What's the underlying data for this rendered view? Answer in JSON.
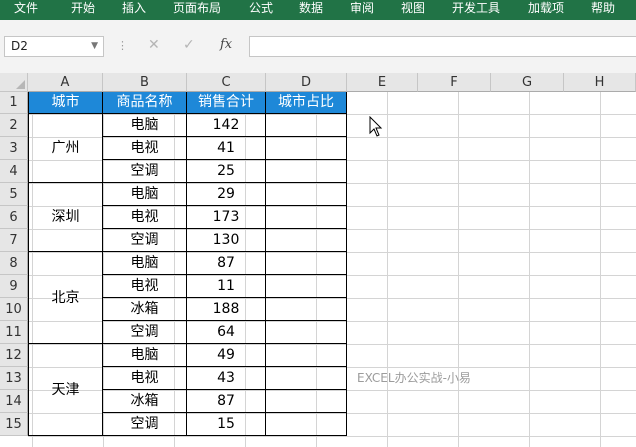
{
  "ribbon": {
    "tabs": [
      "文件",
      "开始",
      "插入",
      "页面布局",
      "公式",
      "数据",
      "审阅",
      "视图",
      "开发工具",
      "加载项",
      "帮助"
    ]
  },
  "formula_bar": {
    "name_box": "D2",
    "cancel": "✕",
    "enter": "✓",
    "fx": "fx",
    "formula": ""
  },
  "columns": [
    "A",
    "B",
    "C",
    "D",
    "E",
    "F",
    "G",
    "H"
  ],
  "rows": [
    "1",
    "2",
    "3",
    "4",
    "5",
    "6",
    "7",
    "8",
    "9",
    "10",
    "11",
    "12",
    "13",
    "14",
    "15"
  ],
  "table": {
    "headers": [
      "城市",
      "商品名称",
      "销售合计",
      "城市占比"
    ],
    "groups": [
      {
        "city": "广州",
        "items": [
          [
            "电脑",
            "142"
          ],
          [
            "电视",
            "41"
          ],
          [
            "空调",
            "25"
          ]
        ]
      },
      {
        "city": "深圳",
        "items": [
          [
            "电脑",
            "29"
          ],
          [
            "电视",
            "173"
          ],
          [
            "空调",
            "130"
          ]
        ]
      },
      {
        "city": "北京",
        "items": [
          [
            "电脑",
            "87"
          ],
          [
            "电视",
            "11"
          ],
          [
            "冰箱",
            "188"
          ],
          [
            "空调",
            "64"
          ]
        ]
      },
      {
        "city": "天津",
        "items": [
          [
            "电脑",
            "49"
          ],
          [
            "电视",
            "43"
          ],
          [
            "冰箱",
            "87"
          ],
          [
            "空调",
            "15"
          ]
        ]
      }
    ]
  },
  "watermark": "EXCEL办公实战-小易",
  "colors": {
    "ribbon": "#217346",
    "header_fill": "#1e88d8"
  }
}
